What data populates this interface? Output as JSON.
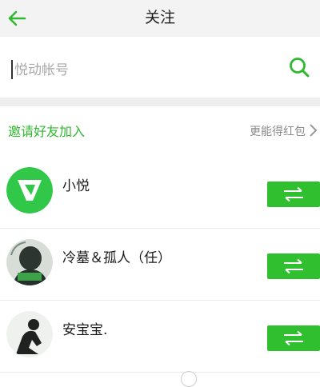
{
  "header": {
    "title": "关注",
    "back_icon": "arrow-left-icon"
  },
  "search": {
    "placeholder": "悦动帐号",
    "value": "",
    "icon": "search-icon"
  },
  "invite": {
    "label": "邀请好友加入",
    "hint": "更能得红包",
    "icon": "chevron-right-icon"
  },
  "list": {
    "items": [
      {
        "name": "小悦",
        "avatar": "yuedong-logo",
        "action_icon": "swap-arrows-icon"
      },
      {
        "name": "冷墓＆孤人（任）",
        "avatar": "anime-character-avatar",
        "action_icon": "swap-arrows-icon"
      },
      {
        "name": "安宝宝.",
        "avatar": "silhouette-avatar",
        "action_icon": "swap-arrows-icon"
      }
    ]
  },
  "colors": {
    "accent": "#2fbf2f",
    "header_bg": "#f3f3f3",
    "divider": "#eeeeee"
  }
}
